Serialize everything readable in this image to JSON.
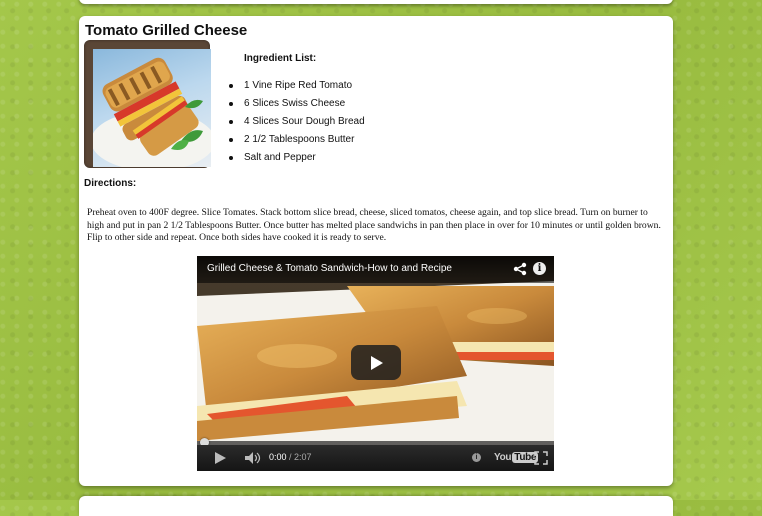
{
  "recipe": {
    "title": "Tomato Grilled Cheese",
    "ingredients_heading": "Ingredient List:",
    "ingredients": [
      "1 Vine Ripe Red Tomato",
      "6 Slices Swiss Cheese",
      "4 Slices Sour Dough Bread",
      "2 1/2 Tablespoons Butter",
      "Salt and Pepper"
    ],
    "directions_heading": "Directions:",
    "directions": "Preheat oven to 400F degree. Slice Tomates. Stack bottom slice bread, cheese, sliced tomatos, cheese again, and top slice bread. Turn on burner to high and put in pan 2 1/2 Tablespoons Butter. Once butter has melted place sandwichs in pan then place in over for 10 minutes or until golden brown. Flip to other side and repeat. Once both sides have cooked it is ready to serve."
  },
  "video": {
    "title": "Grilled Cheese & Tomato Sandwich-How to and Recipe",
    "current_time": "0:00",
    "separator": " / ",
    "duration": "2:07",
    "progress_fraction": 0,
    "logo_you": "You",
    "logo_tube": "Tube",
    "info_label": "i",
    "cc_label": "i"
  },
  "colors": {
    "page_background": "#9fc145",
    "card": "#ffffff",
    "photo_frame": "#5a4636",
    "progress": "#cc0000"
  },
  "icons": [
    "share-icon",
    "info-icon",
    "play-icon",
    "volume-icon",
    "fullscreen-icon",
    "youtube-logo"
  ]
}
